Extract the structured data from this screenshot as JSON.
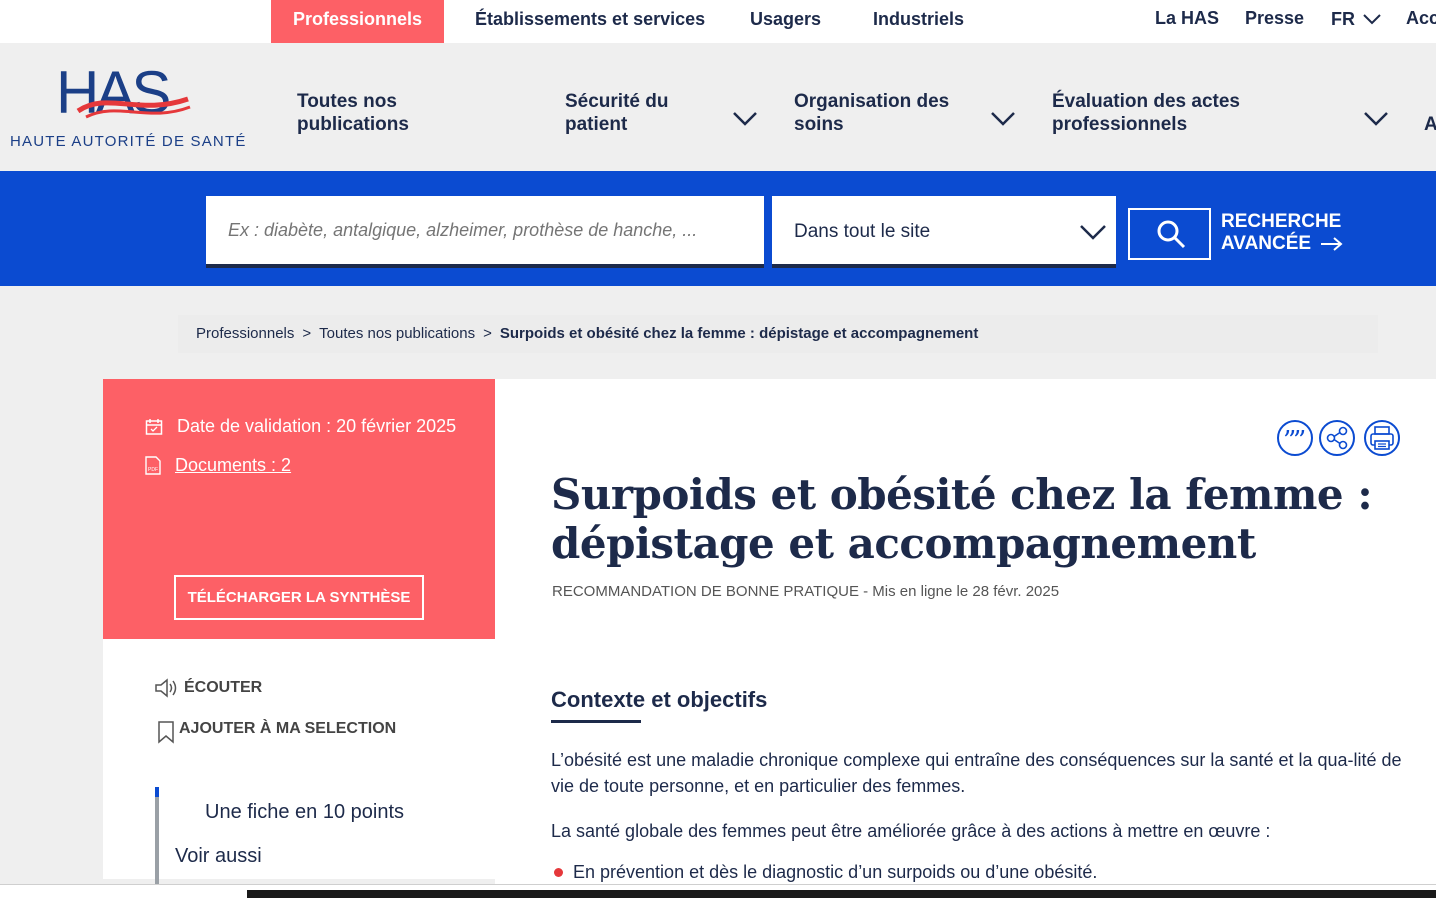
{
  "topbar": {
    "audiences": [
      "Professionnels",
      "Établissements et services",
      "Usagers",
      "Industriels"
    ],
    "utility": [
      "La HAS",
      "Presse",
      "FR",
      "Acc"
    ]
  },
  "logo": {
    "letters": "HAS",
    "subtitle": "HAUTE AUTORITÉ DE SANTÉ"
  },
  "nav": {
    "items": [
      {
        "label_line1": "Toutes nos",
        "label_line2": "publications"
      },
      {
        "label_line1": "Sécurité du",
        "label_line2": "patient"
      },
      {
        "label_line1": "Organisation des",
        "label_line2": "soins"
      },
      {
        "label_line1": "Évaluation des actes",
        "label_line2": "professionnels"
      }
    ],
    "overflow": "A"
  },
  "search": {
    "placeholder": "Ex : diabète, antalgique, alzheimer, prothèse de hanche, ...",
    "scope": "Dans tout le site",
    "advanced_line1": "RECHERCHE",
    "advanced_line2": "AVANCÉE"
  },
  "breadcrumb": {
    "items": [
      "Professionnels",
      "Toutes nos publications"
    ],
    "current": "Surpoids et obésité chez la femme : dépistage et accompagnement",
    "separator": ">"
  },
  "sidebar": {
    "validation": "Date de validation : 20 février 2025",
    "documents": "Documents : 2",
    "download": "TÉLÉCHARGER LA SYNTHÈSE",
    "listen": "ÉCOUTER",
    "add_selection": "AJOUTER À MA SELECTION",
    "toc": [
      "Une fiche en 10 points",
      "Voir aussi"
    ]
  },
  "article": {
    "title": "Surpoids et obésité chez la femme : dépistage et accompagnement",
    "type": "RECOMMANDATION DE BONNE PRATIQUE",
    "published": " - Mis en ligne le 28 févr. 2025",
    "section_title": "Contexte et objectifs",
    "paragraph1": "L’obésité est une maladie chronique complexe qui entraîne des conséquences sur la santé et la qua-lité de vie de toute personne, et en particulier des femmes.",
    "paragraph2": "La santé globale des femmes peut être améliorée grâce à des actions à mettre en œuvre :",
    "bullet1": "En prévention et dès le diagnostic d’un surpoids ou d’une obésité."
  },
  "colors": {
    "accent_red": "#fd6066",
    "brand_blue": "#0b4bd1",
    "navy": "#1d2a4a"
  }
}
